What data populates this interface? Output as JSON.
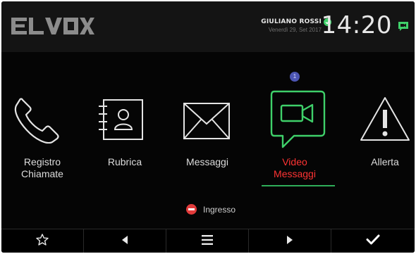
{
  "header": {
    "brand": "ELVOX",
    "user_name": "GIULIANO ROSSI",
    "date": "Venerdì 29, Set 2017",
    "time": "14:20",
    "accent_color": "#3fd06a"
  },
  "apps": [
    {
      "id": "call-log",
      "label_line1": "Registro",
      "label_line2": "Chiamate",
      "icon": "phone-handset-icon"
    },
    {
      "id": "contacts",
      "label_line1": "Rubrica",
      "label_line2": "",
      "icon": "address-book-icon"
    },
    {
      "id": "messages",
      "label_line1": "Messaggi",
      "label_line2": "",
      "icon": "envelope-icon"
    },
    {
      "id": "video-messages",
      "label_line1": "Video",
      "label_line2": "Messaggi",
      "icon": "video-camera-icon",
      "active": true,
      "badge": "1"
    },
    {
      "id": "alert",
      "label_line1": "Allerta",
      "label_line2": "",
      "icon": "warning-triangle-icon"
    }
  ],
  "status": {
    "label": "Ingresso",
    "icon": "do-not-disturb-icon",
    "color": "#e23b3b"
  },
  "bottom_nav": [
    {
      "id": "favorites",
      "icon": "star-icon"
    },
    {
      "id": "previous",
      "icon": "left-arrow-icon"
    },
    {
      "id": "menu",
      "icon": "menu-icon"
    },
    {
      "id": "next",
      "icon": "right-arrow-icon"
    },
    {
      "id": "confirm",
      "icon": "checkmark-icon"
    }
  ],
  "colors": {
    "active_label": "#ff3333",
    "active_icon": "#3fd06a",
    "badge": "#4c55b3"
  }
}
